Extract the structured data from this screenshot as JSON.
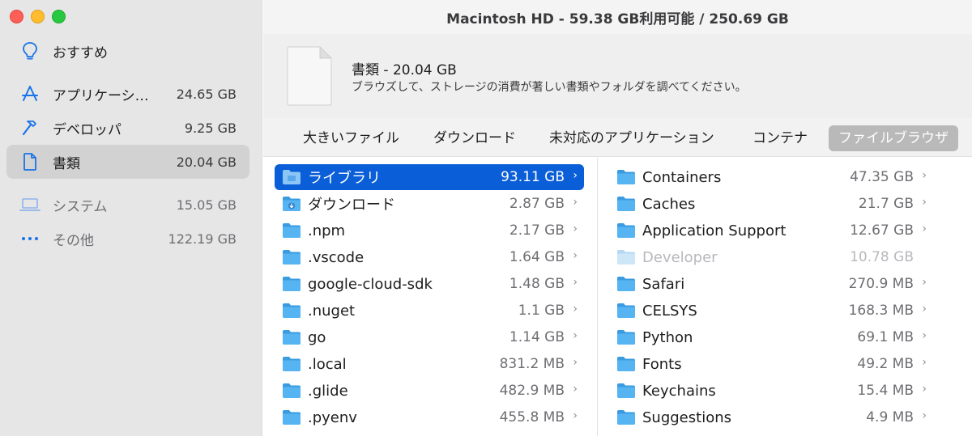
{
  "window": {
    "title": "Macintosh HD - 59.38 GB利用可能 / 250.69 GB"
  },
  "sidebar": {
    "items": [
      {
        "label": "おすすめ",
        "size": "",
        "icon": "lightbulb-icon"
      },
      {
        "label": "アプリケーシ…",
        "size": "24.65 GB",
        "icon": "app-store-icon"
      },
      {
        "label": "デベロッパ",
        "size": "9.25 GB",
        "icon": "hammer-icon"
      },
      {
        "label": "書類",
        "size": "20.04 GB",
        "icon": "document-icon",
        "selected": true
      },
      {
        "label": "システム",
        "size": "15.05 GB",
        "icon": "laptop-icon"
      },
      {
        "label": "その他",
        "size": "122.19 GB",
        "icon": "ellipsis-icon"
      }
    ]
  },
  "header": {
    "title": "書類 - 20.04 GB",
    "description": "ブラウズして、ストレージの消費が著しい書類やフォルダを調べてください。",
    "icon": "blank-document-icon"
  },
  "tabs": [
    {
      "label": "大きいファイル"
    },
    {
      "label": "ダウンロード"
    },
    {
      "label": "未対応のアプリケーション"
    },
    {
      "label": "コンテナ"
    },
    {
      "label": "ファイルブラウザ",
      "active": true
    }
  ],
  "left_column": [
    {
      "name": "ライブラリ",
      "size": "93.11 GB",
      "selected": true
    },
    {
      "name": "ダウンロード",
      "size": "2.87 GB",
      "icon": "downloads-folder-icon"
    },
    {
      "name": ".npm",
      "size": "2.17 GB"
    },
    {
      "name": ".vscode",
      "size": "1.64 GB"
    },
    {
      "name": "google-cloud-sdk",
      "size": "1.48 GB"
    },
    {
      "name": ".nuget",
      "size": "1.1 GB"
    },
    {
      "name": "go",
      "size": "1.14 GB"
    },
    {
      "name": ".local",
      "size": "831.2 MB"
    },
    {
      "name": ".glide",
      "size": "482.9 MB"
    },
    {
      "name": ".pyenv",
      "size": "455.8 MB"
    }
  ],
  "right_column": [
    {
      "name": "Containers",
      "size": "47.35 GB"
    },
    {
      "name": "Caches",
      "size": "21.7 GB"
    },
    {
      "name": "Application Support",
      "size": "12.67 GB"
    },
    {
      "name": "Developer",
      "size": "10.78 GB",
      "disabled": true
    },
    {
      "name": "Safari",
      "size": "270.9 MB"
    },
    {
      "name": "CELSYS",
      "size": "168.3 MB"
    },
    {
      "name": "Python",
      "size": "69.1 MB"
    },
    {
      "name": "Fonts",
      "size": "49.2 MB"
    },
    {
      "name": "Keychains",
      "size": "15.4 MB"
    },
    {
      "name": "Suggestions",
      "size": "4.9 MB"
    }
  ],
  "chevron": "›",
  "colors": {
    "accent": "#0a5ed7",
    "folder": "#56b4f2",
    "sidebar_icon": "#1a73e8"
  }
}
